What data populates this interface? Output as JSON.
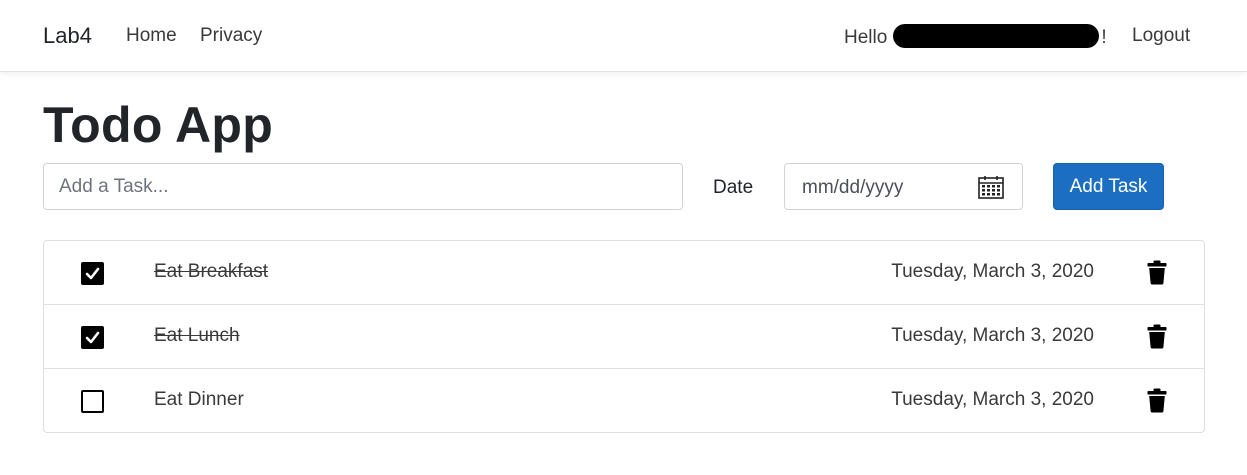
{
  "nav": {
    "brand": "Lab4",
    "links": [
      "Home",
      "Privacy"
    ],
    "hello": "Hello",
    "hello_suffix": "!",
    "logout": "Logout"
  },
  "page": {
    "title": "Todo App"
  },
  "form": {
    "task_placeholder": "Add a Task...",
    "date_label": "Date",
    "date_placeholder": "mm/dd/yyyy",
    "add_button": "Add Task"
  },
  "tasks": [
    {
      "text": "Eat Breakfast",
      "done": true,
      "date": "Tuesday, March 3, 2020"
    },
    {
      "text": "Eat Lunch",
      "done": true,
      "date": "Tuesday, March 3, 2020"
    },
    {
      "text": "Eat Dinner",
      "done": false,
      "date": "Tuesday, March 3, 2020"
    }
  ],
  "icons": {
    "calendar": "calendar-icon",
    "delete": "trash-icon",
    "check": "check-icon"
  },
  "colors": {
    "primary_button": "#1b6ec2",
    "text": "#212529"
  }
}
